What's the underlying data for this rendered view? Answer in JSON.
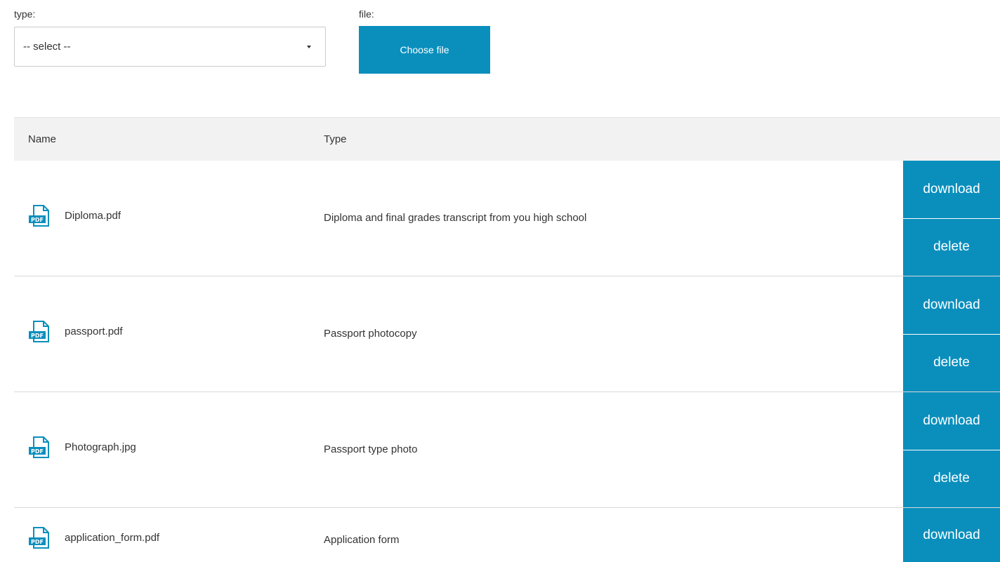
{
  "form": {
    "type_label": "type:",
    "type_select_value": "-- select --",
    "file_label": "file:",
    "choose_file_label": "Choose file"
  },
  "table": {
    "columns": [
      "Name",
      "Type"
    ],
    "rows": [
      {
        "name": "Diploma.pdf",
        "type": "Diploma and final grades transcript from you high school",
        "icon": "pdf-file-icon",
        "download_label": "download",
        "delete_label": "delete"
      },
      {
        "name": "passport.pdf",
        "type": "Passport photocopy",
        "icon": "pdf-file-icon",
        "download_label": "download",
        "delete_label": "delete"
      },
      {
        "name": "Photograph.jpg",
        "type": "Passport type photo",
        "icon": "pdf-file-icon",
        "download_label": "download",
        "delete_label": "delete"
      },
      {
        "name": "application_form.pdf",
        "type": "Application form",
        "icon": "pdf-file-icon",
        "download_label": "download"
      }
    ]
  },
  "colors": {
    "accent": "#0a8fbd",
    "header_bg": "#f2f2f2",
    "text": "#333333"
  }
}
